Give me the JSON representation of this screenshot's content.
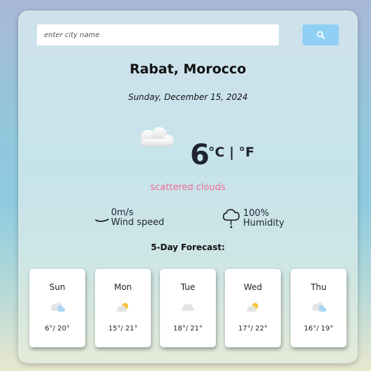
{
  "search": {
    "placeholder": "enter city name",
    "button_icon": "search-icon"
  },
  "location": "Rabat, Morocco",
  "date": "Sunday, December 15, 2024",
  "current": {
    "icon": "scattered-clouds-icon",
    "temperature": "6",
    "unit_celsius": "°C",
    "separator": " | ",
    "unit_fahrenheit": "°F",
    "description": "scattered clouds"
  },
  "stats": {
    "wind": {
      "icon": "wind-icon",
      "value": "0m/s",
      "label": "Wind speed"
    },
    "humidity": {
      "icon": "humidity-icon",
      "value": "100%",
      "label": "Humidity"
    }
  },
  "forecast": {
    "title": "5-Day Forecast:",
    "days": [
      {
        "day": "Sun",
        "icon": "rain-cloud-icon",
        "temps": "6°/ 20°"
      },
      {
        "day": "Mon",
        "icon": "partly-sunny-icon",
        "temps": "15°/ 21°"
      },
      {
        "day": "Tue",
        "icon": "cloud-icon",
        "temps": "18°/ 21°"
      },
      {
        "day": "Wed",
        "icon": "partly-sunny-icon",
        "temps": "17°/ 22°"
      },
      {
        "day": "Thu",
        "icon": "rain-cloud-icon",
        "temps": "16°/ 19°"
      }
    ]
  },
  "colors": {
    "search_button": "#8fd0f4",
    "description": "#f06896",
    "text_dark": "#1e2430"
  }
}
